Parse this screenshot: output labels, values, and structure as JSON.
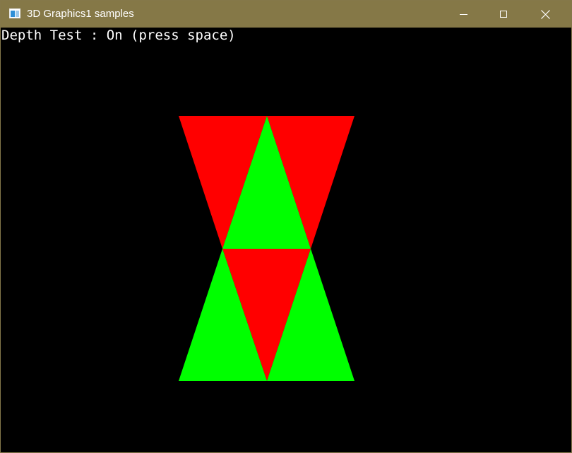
{
  "window": {
    "title": "3D Graphics1 samples",
    "titlebar_color": "#857847"
  },
  "caption_buttons": {
    "minimize_icon": "minimize-icon",
    "maximize_icon": "maximize-icon",
    "close_icon": "close-icon"
  },
  "viewport": {
    "background_color": "#000000",
    "status_text": "Depth Test : On (press space)"
  },
  "scene": {
    "colors": {
      "red": "#ff0000",
      "green": "#00ff00"
    }
  }
}
